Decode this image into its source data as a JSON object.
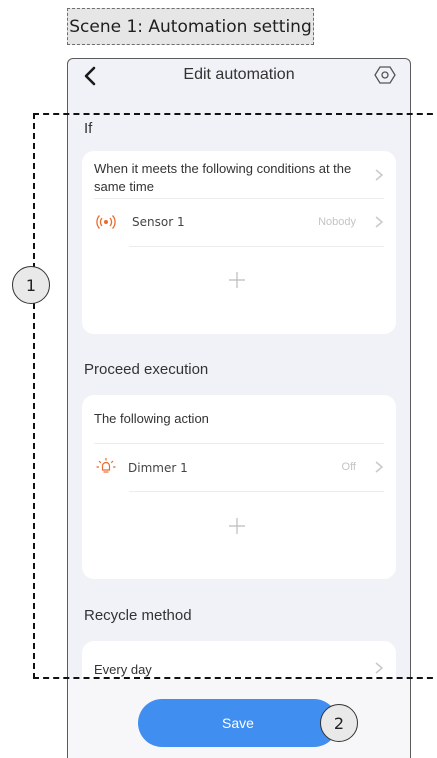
{
  "scene_label": "Scene 1: Automation setting",
  "header": {
    "title": "Edit automation",
    "back_icon": "chevron-left-icon",
    "settings_icon": "hexagon-settings-icon"
  },
  "if_section": {
    "title": "If",
    "condition_text": "When it meets the following conditions at the same time",
    "items": [
      {
        "icon": "sensor-icon",
        "label": "Sensor 1",
        "value": "Nobody"
      }
    ],
    "add_icon": "plus-icon"
  },
  "execution_section": {
    "title": "Proceed execution",
    "action_text": "The following action",
    "items": [
      {
        "icon": "light-bulb-icon",
        "label": "Dimmer 1",
        "value": "Off"
      }
    ],
    "add_icon": "plus-icon"
  },
  "recycle_section": {
    "title": "Recycle method",
    "value": "Every day"
  },
  "save_label": "Save",
  "callouts": [
    "1",
    "2"
  ],
  "colors": {
    "primary": "#3f8ef0",
    "background": "#f1f2f7",
    "card": "#ffffff",
    "muted_text": "#c4c4c4"
  }
}
